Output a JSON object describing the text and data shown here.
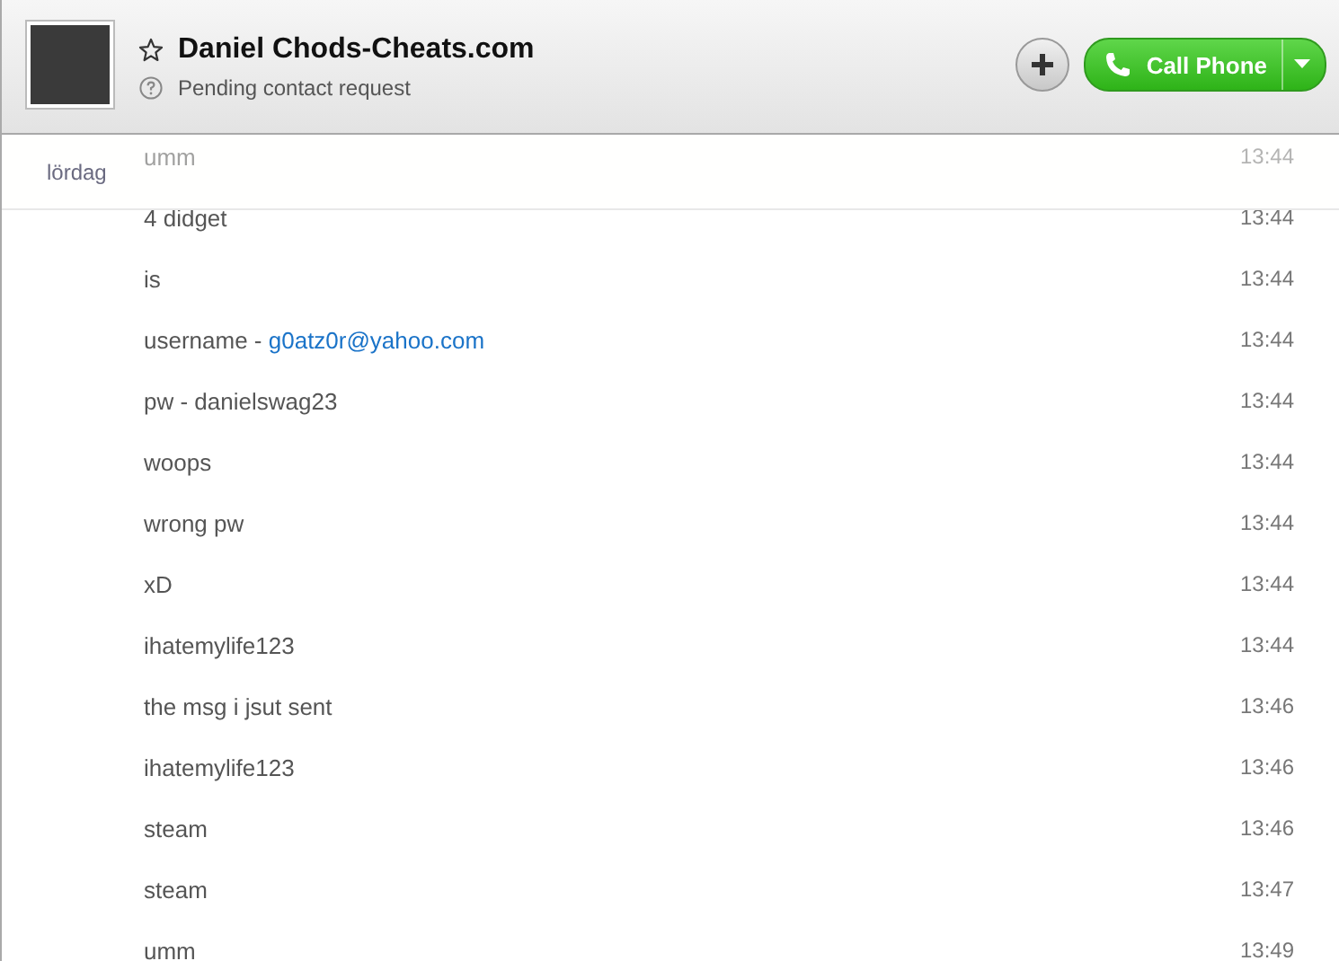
{
  "contact": {
    "name": "Daniel Chods-Cheats.com",
    "status": "Pending contact request"
  },
  "call_button": {
    "label": "Call Phone"
  },
  "day_label": "lördag",
  "messages": [
    {
      "text": "umm",
      "time": "13:44"
    },
    {
      "text": "4 didget",
      "time": "13:44"
    },
    {
      "text": "is",
      "time": "13:44"
    },
    {
      "text": "username - ",
      "link": "g0atz0r@yahoo.com",
      "time": "13:44"
    },
    {
      "text": "pw - danielswag23",
      "time": "13:44"
    },
    {
      "text": "woops",
      "time": "13:44"
    },
    {
      "text": "wrong pw",
      "time": "13:44"
    },
    {
      "text": "xD",
      "time": "13:44"
    },
    {
      "text": "ihatemylife123",
      "time": "13:44"
    },
    {
      "text": "the msg i jsut sent",
      "time": "13:46"
    },
    {
      "text": "ihatemylife123",
      "time": "13:46"
    },
    {
      "text": "steam",
      "time": "13:46"
    },
    {
      "text": "steam",
      "time": "13:47"
    },
    {
      "text": "umm",
      "time": "13:49"
    }
  ]
}
